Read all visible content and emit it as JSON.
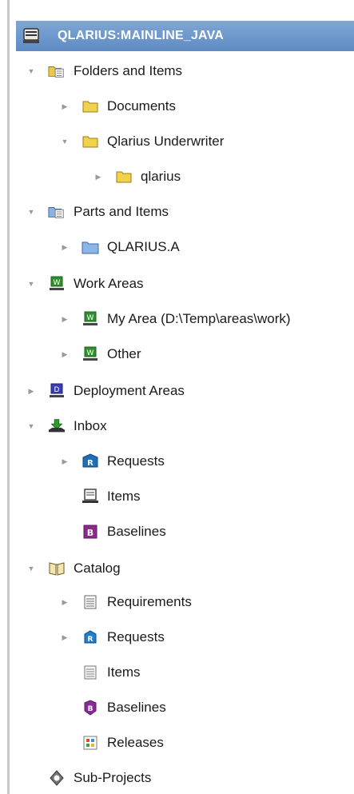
{
  "header": {
    "label": "QLARIUS:MAINLINE_JAVA",
    "icon": "server-icon"
  },
  "tree": [
    {
      "label": "Folders and Items",
      "icon": "folders-items-icon",
      "expanded": true
    },
    {
      "label": "Documents",
      "icon": "folder-icon",
      "expanded": false
    },
    {
      "label": "Qlarius Underwriter",
      "icon": "folder-icon",
      "expanded": true
    },
    {
      "label": "qlarius",
      "icon": "folder-icon",
      "expanded": false
    },
    {
      "label": "Parts and Items",
      "icon": "parts-items-icon",
      "expanded": true
    },
    {
      "label": "QLARIUS.A",
      "icon": "part-folder-icon",
      "expanded": false
    },
    {
      "label": "Work Areas",
      "icon": "work-area-icon",
      "expanded": true
    },
    {
      "label": "My Area (D:\\Temp\\areas\\work)",
      "icon": "work-area-icon",
      "expanded": false
    },
    {
      "label": "Other",
      "icon": "work-area-icon",
      "expanded": false
    },
    {
      "label": "Deployment Areas",
      "icon": "deployment-area-icon",
      "expanded": false
    },
    {
      "label": "Inbox",
      "icon": "inbox-icon",
      "expanded": true
    },
    {
      "label": "Requests",
      "icon": "request-icon",
      "expanded": false
    },
    {
      "label": "Items",
      "icon": "items-icon",
      "expanded": null
    },
    {
      "label": "Baselines",
      "icon": "baseline-icon",
      "expanded": null
    },
    {
      "label": "Catalog",
      "icon": "catalog-icon",
      "expanded": true
    },
    {
      "label": "Requirements",
      "icon": "requirements-icon",
      "expanded": false
    },
    {
      "label": "Requests",
      "icon": "request-small-icon",
      "expanded": false
    },
    {
      "label": "Items",
      "icon": "items-small-icon",
      "expanded": null
    },
    {
      "label": "Baselines",
      "icon": "baseline-small-icon",
      "expanded": null
    },
    {
      "label": "Releases",
      "icon": "releases-icon",
      "expanded": null
    },
    {
      "label": "Sub-Projects",
      "icon": "sub-projects-icon",
      "expanded": null
    }
  ]
}
